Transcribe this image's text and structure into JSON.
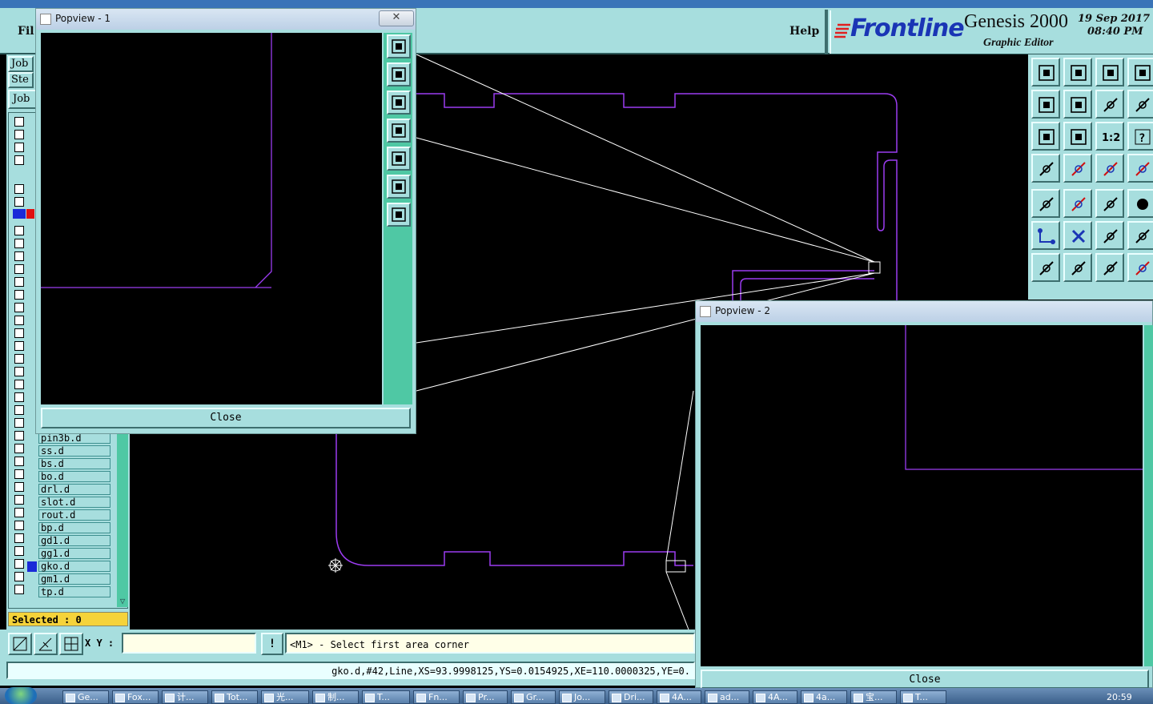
{
  "menubar": {
    "file_label": "Fil",
    "help_label": "Help",
    "logo_text": "Frontline",
    "product_name": "Genesis 2000",
    "product_subtitle": "Graphic Editor",
    "date_line1": "19 Sep 2017",
    "date_line2": "08:40 PM"
  },
  "left_panel": {
    "job_label": "Job",
    "step_label": "Ste",
    "job_button": "Job",
    "layers": [
      {
        "name": "pin3b.d"
      },
      {
        "name": "ss.d"
      },
      {
        "name": "bs.d"
      },
      {
        "name": "bo.d"
      },
      {
        "name": "drl.d"
      },
      {
        "name": "slot.d"
      },
      {
        "name": "rout.d"
      },
      {
        "name": "bp.d"
      },
      {
        "name": "gd1.d"
      },
      {
        "name": "gg1.d"
      },
      {
        "name": "gko.d"
      },
      {
        "name": "gm1.d"
      },
      {
        "name": "tp.d"
      }
    ],
    "selected_text": "Selected : 0"
  },
  "command_bar": {
    "xy_label": "X Y :",
    "xy_value": "",
    "prompt_text": "<M1> - Select first area corner",
    "status_text": "gko.d,#42,Line,XS=93.9998125,YS=0.0154925,XE=110.0000325,YE=0."
  },
  "popview1": {
    "title": "Popview - 1",
    "close_label": "Close",
    "close_x": "✕"
  },
  "popview2": {
    "title": "Popview - 2",
    "close_label": "Close"
  },
  "taskbar": {
    "items": [
      "Ge...",
      "Fox...",
      "计...",
      "Tot...",
      "光...",
      "制...",
      "T...",
      "Fn...",
      "Pr...",
      "Gr...",
      "Jo...",
      "Dri...",
      "4A...",
      "ad...",
      "4A...",
      "4a...",
      "宝...",
      "T..."
    ],
    "clock": "20:59"
  },
  "colors": {
    "panel": "#a7dede",
    "accent_mint": "#4fc8a4",
    "outline_purple": "#9b3cf0",
    "logo_blue": "#1a35b5",
    "selected_yellow": "#f5d33a"
  }
}
